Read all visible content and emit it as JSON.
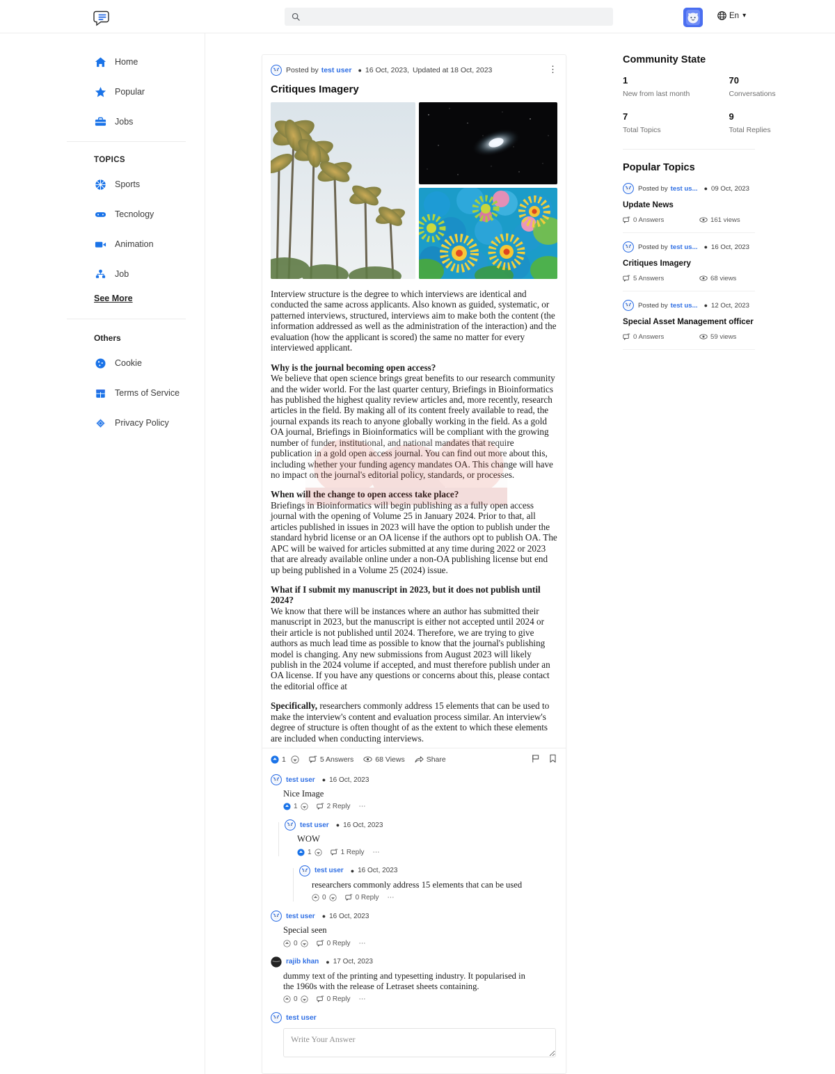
{
  "header": {
    "logo_icon": "chat-bubble-logo",
    "search": {
      "value": "",
      "placeholder": "",
      "icon": "search-icon"
    },
    "avatar_alt": "user-avatar",
    "language": "En",
    "language_icon": "globe-icon",
    "chevron": "⌄"
  },
  "sidebar": {
    "main_items": [
      {
        "label": "Home",
        "icon": "home-icon"
      },
      {
        "label": "Popular",
        "icon": "star-icon"
      },
      {
        "label": "Jobs",
        "icon": "briefcase-icon"
      }
    ],
    "topics_heading": "TOPICS",
    "topic_items": [
      {
        "label": "Sports",
        "icon": "basketball-icon"
      },
      {
        "label": "Tecnology",
        "icon": "gamepad-icon"
      },
      {
        "label": "Animation",
        "icon": "video-camera-icon"
      },
      {
        "label": "Job",
        "icon": "org-chart-icon"
      }
    ],
    "see_more": "See More",
    "others_heading": "Others",
    "other_items": [
      {
        "label": "Cookie",
        "icon": "cookie-icon"
      },
      {
        "label": "Terms of Service",
        "icon": "document-icon"
      },
      {
        "label": "Privacy Policy",
        "icon": "shield-diamond-icon"
      }
    ]
  },
  "post": {
    "posted_by_prefix": "Posted by",
    "author": "test user",
    "date": "16 Oct, 2023,",
    "updated": "Updated at 18 Oct, 2023",
    "kebab_icon": "more-vertical-icon",
    "title": "Critiques Imagery",
    "images": [
      {
        "name": "palm-trees-photo"
      },
      {
        "name": "galaxy-night-sky-photo"
      },
      {
        "name": "coral-anemones-photo"
      }
    ],
    "paragraphs": [
      {
        "type": "plain",
        "text": "Interview structure is the degree to which interviews are identical and conducted the same across applicants. Also known as guided, systematic, or patterned interviews, structured, interviews aim to make both the content (the information addressed as well as the administration of the interaction) and the evaluation (how the applicant is scored) the same no matter for every interviewed applicant."
      },
      {
        "type": "qa",
        "question": "Why is the journal becoming open access?",
        "text": "We believe that open science brings great benefits to our research community and the wider world. For the last quarter century, Briefings in Bioinformatics has published the highest quality review articles and, more recently, research articles in the field. By making all of its content freely available to read, the journal expands its reach to anyone globally working in the field. As a gold OA journal, Briefings in Bioinformatics will be compliant with the growing number of funder, institutional, and national mandates that require publication in a gold open access journal. You can find out more about this, including whether your funding agency mandates OA. This change will have no impact on the journal's editorial policy, standards, or processes."
      },
      {
        "type": "qa",
        "question": "When will the change to open access take place?",
        "text": "Briefings in Bioinformatics will begin publishing as a fully open access journal with the opening of Volume 25 in January 2024. Prior to that, all articles published in issues in 2023 will have the option to publish under the standard hybrid license or an OA license if the authors opt to publish OA. The APC will be waived for articles submitted at any time during 2022 or 2023 that are already available online under a non-OA publishing license but end up being published in a Volume 25 (2024) issue."
      },
      {
        "type": "qa",
        "question": "What if I submit my manuscript in 2023, but it does not publish until 2024?",
        "text": "We know that there will be instances where an author has submitted their manuscript in 2023, but the manuscript is either not accepted until 2024 or their article is not published until 2024. Therefore, we are trying to give authors as much lead time as possible to know that the journal's publishing model is changing. Any new submissions from August 2023 will likely publish in the 2024 volume if accepted, and must therefore publish under an OA license. If you have any questions or concerns about this, please contact the editorial office at"
      },
      {
        "type": "lead",
        "lead": "Specifically,",
        "text": " researchers commonly address 15 elements that can be used to make the interview's content and evaluation process similar. An interview's degree of structure is often thought of as the extent to which these elements are included when conducting interviews."
      }
    ],
    "actions": {
      "upvote_count": "1",
      "upvote_icon": "arrow-up-circle-filled-icon",
      "downvote_icon": "arrow-down-circle-icon",
      "answers": "5 Answers",
      "answers_icon": "comment-icon",
      "views": "68 Views",
      "views_icon": "eye-icon",
      "share": "Share",
      "share_icon": "share-icon",
      "flag_icon": "flag-icon",
      "bookmark_icon": "bookmark-icon"
    }
  },
  "comments": [
    {
      "user": "test user",
      "date": "16 Oct, 2023",
      "text": "Nice Image",
      "votes": "1",
      "replies": "2 Reply",
      "indent": 0,
      "upvoted": true
    },
    {
      "user": "test user",
      "date": "16 Oct, 2023",
      "text": "WOW",
      "votes": "1",
      "replies": "1 Reply",
      "indent": 1,
      "upvoted": true
    },
    {
      "user": "test user",
      "date": "16 Oct, 2023",
      "text": "researchers commonly address 15 elements that can be used",
      "votes": "0",
      "replies": "0 Reply",
      "indent": 2,
      "upvoted": false
    },
    {
      "user": "test user",
      "date": "16 Oct, 2023",
      "text": "Special seen",
      "votes": "0",
      "replies": "0 Reply",
      "indent": 0,
      "upvoted": false
    },
    {
      "user": "rajib khan",
      "date": "17 Oct, 2023",
      "text": "dummy text of the printing and typesetting industry. It popularised in the 1960s with the release of Letraset sheets containing.",
      "votes": "0",
      "replies": "0 Reply",
      "indent": 0,
      "upvoted": false
    }
  ],
  "answer_box": {
    "user": "test user",
    "placeholder": "Write Your Answer",
    "value": ""
  },
  "community_state": {
    "title": "Community State",
    "stats": [
      {
        "num": "1",
        "label": "New from last month"
      },
      {
        "num": "70",
        "label": "Conversations"
      },
      {
        "num": "7",
        "label": "Total Topics"
      },
      {
        "num": "9",
        "label": "Total Replies"
      }
    ]
  },
  "popular_topics": {
    "title": "Popular Topics",
    "items": [
      {
        "posted_by": "Posted by",
        "user": "test us...",
        "date": "09 Oct, 2023",
        "title": "Update News",
        "answers": "0 Answers",
        "views": "161 views"
      },
      {
        "posted_by": "Posted by",
        "user": "test us...",
        "date": "16 Oct, 2023",
        "title": "Critiques Imagery",
        "answers": "5 Answers",
        "views": "68 views"
      },
      {
        "posted_by": "Posted by",
        "user": "test us...",
        "date": "12 Oct, 2023",
        "title": "Special Asset Management officer",
        "answers": "0 Answers",
        "views": "59 views"
      }
    ]
  },
  "colors": {
    "accent": "#2f6fe4",
    "icon_blue": "#1a73e8",
    "link": "#2f6fe4",
    "muted": "#6f6f6f",
    "border": "#ededed",
    "search_bg": "#f1f2f3"
  }
}
